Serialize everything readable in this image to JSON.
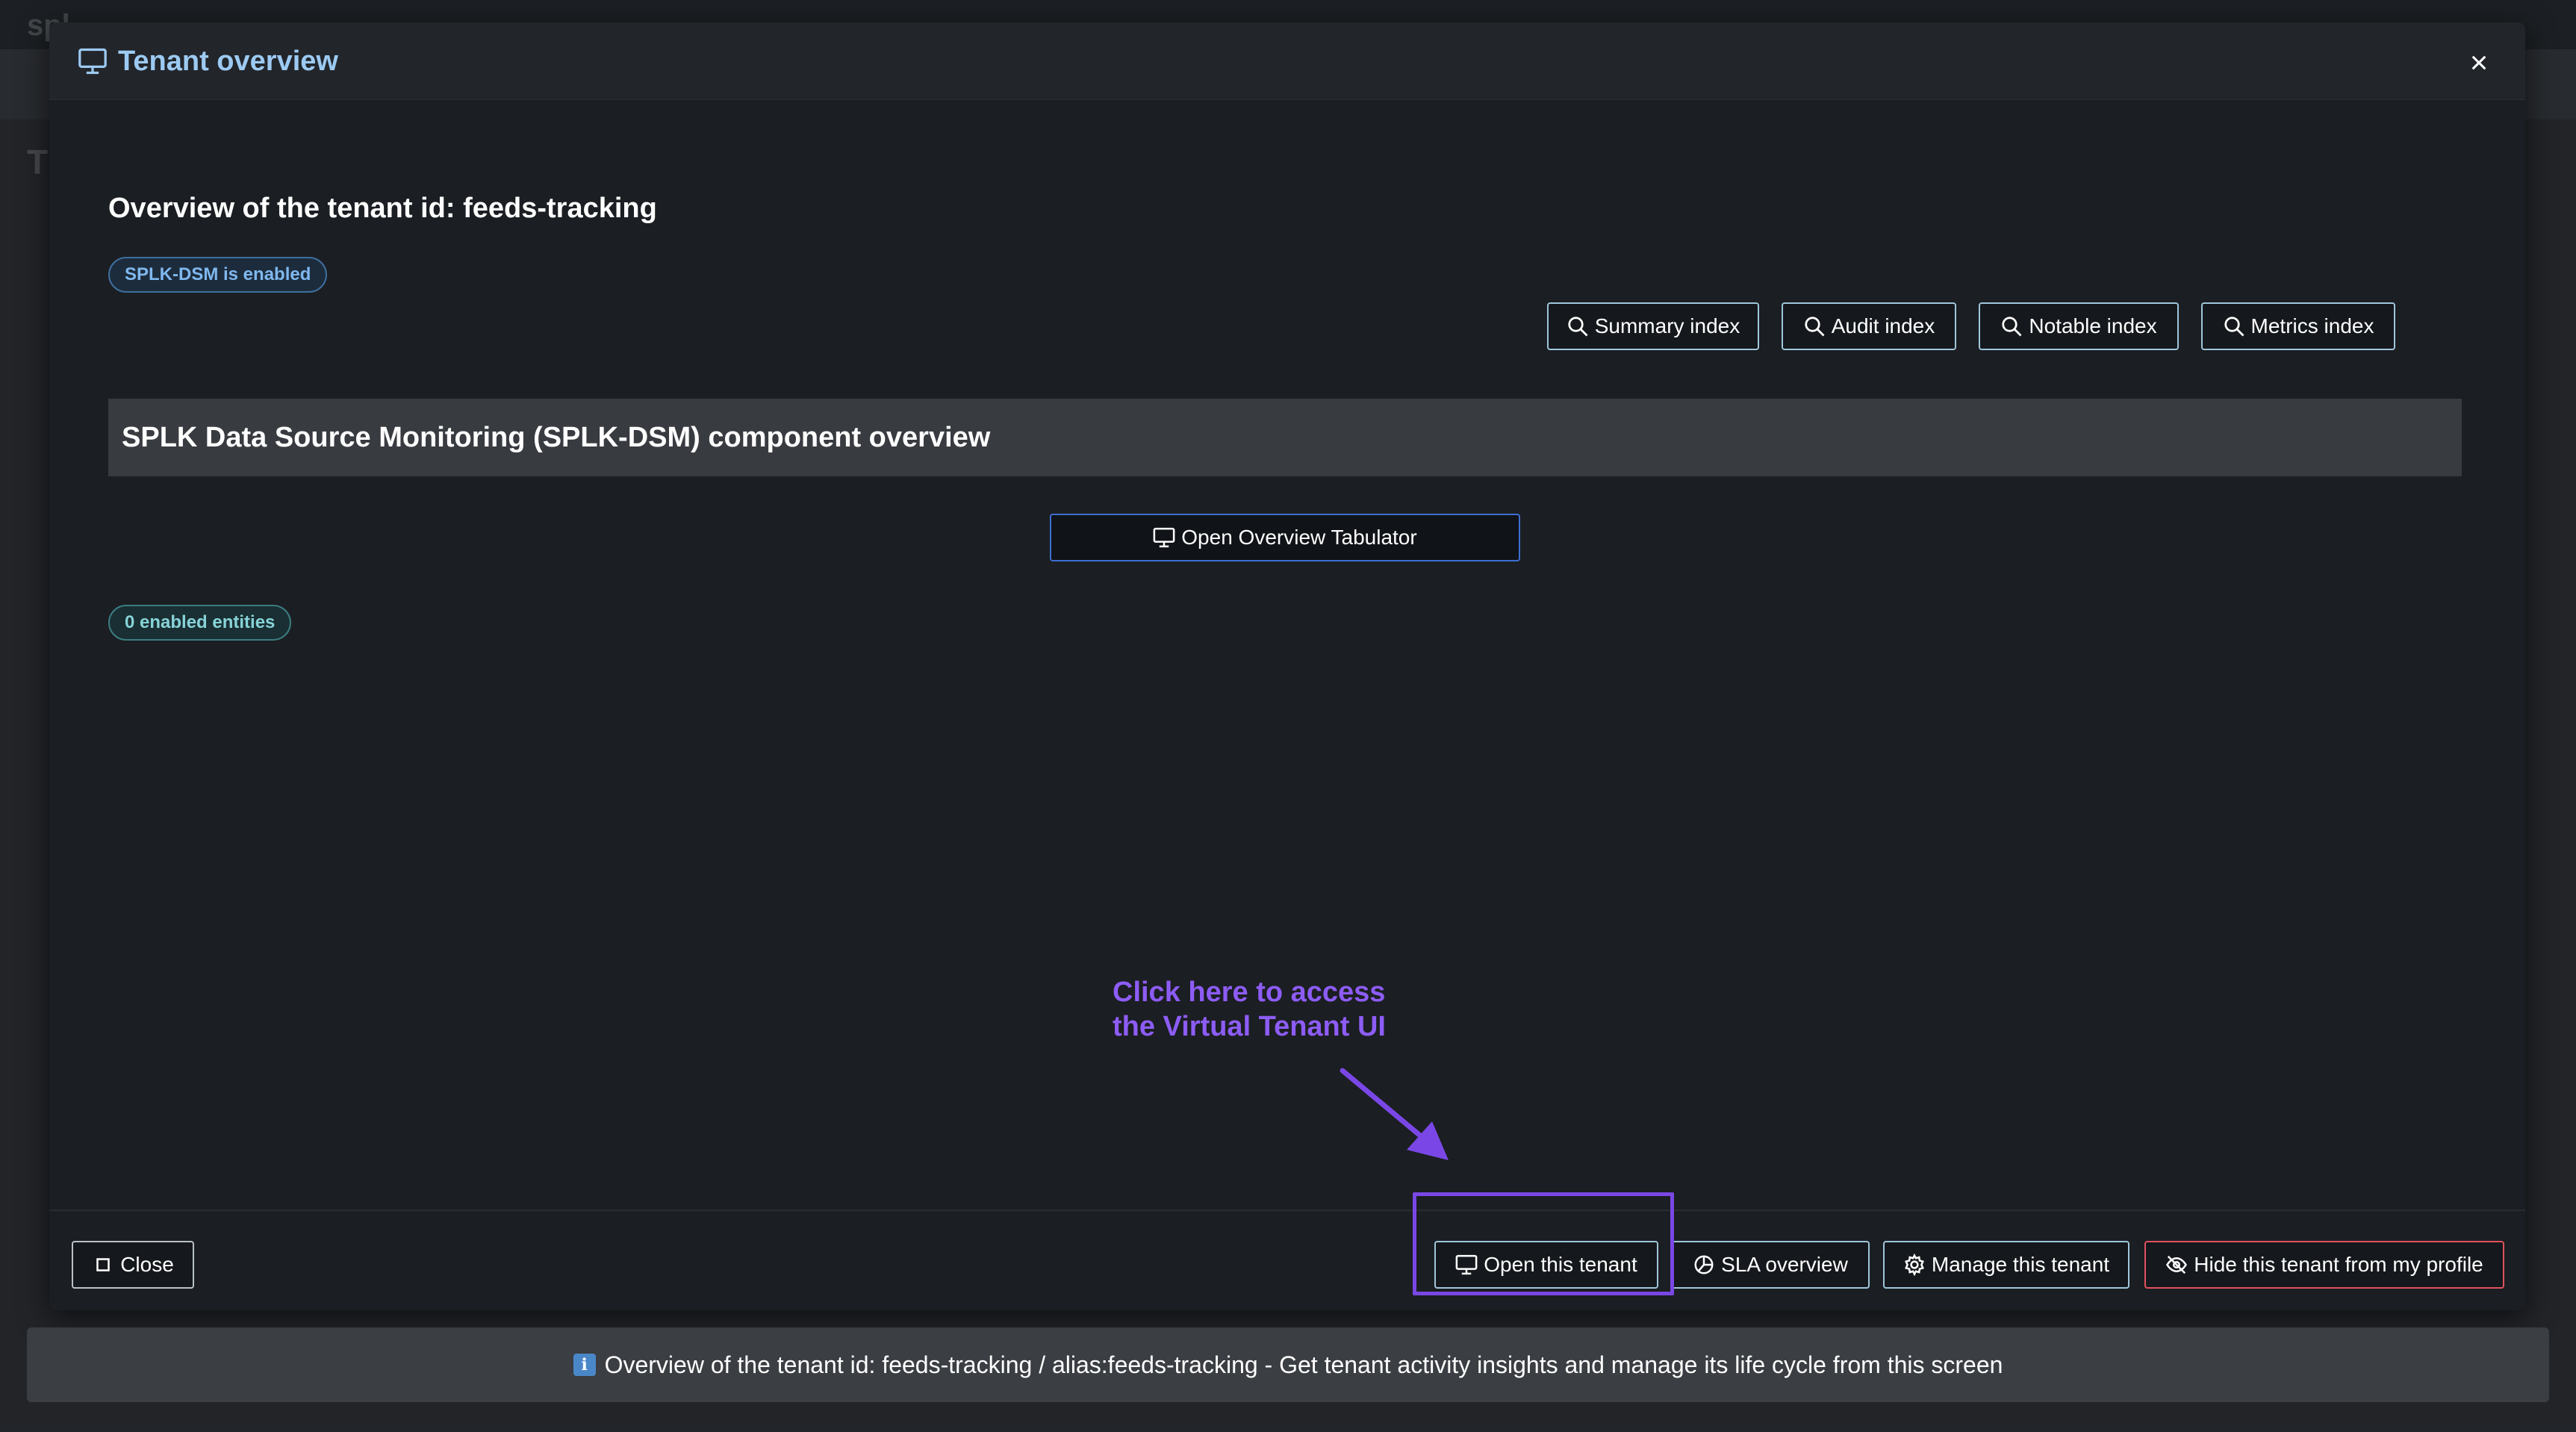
{
  "modal": {
    "title": "Tenant overview",
    "close_x": "×"
  },
  "overview": {
    "title": "Overview of the tenant id: feeds-tracking",
    "status_badge": "SPLK-DSM is enabled"
  },
  "index_buttons": {
    "summary": "Summary index",
    "audit": "Audit index",
    "notable": "Notable index",
    "metrics": "Metrics index"
  },
  "component": {
    "title": "SPLK Data Source Monitoring (SPLK-DSM) component overview",
    "tabulator_button": "Open Overview Tabulator",
    "entities_badge": "0 enabled entities"
  },
  "annotation": {
    "line1": "Click here to access",
    "line2": "the Virtual Tenant UI",
    "color": "#8d5cf5"
  },
  "footer": {
    "close": "Close",
    "open_tenant": "Open this tenant",
    "sla_overview": "SLA overview",
    "manage_tenant": "Manage this tenant",
    "hide_tenant": "Hide this tenant from my profile"
  },
  "info_bar": {
    "icon": "ℹ",
    "text": "Overview of the tenant id: feeds-tracking / alias:feeds-tracking - Get tenant activity insights and manage its life cycle from this screen"
  },
  "icons": {
    "monitor": "monitor-icon",
    "search": "search-icon",
    "pie": "pie-chart-icon",
    "gear": "gear-icon",
    "eye_slash": "eye-slash-icon",
    "square": "square-icon"
  }
}
